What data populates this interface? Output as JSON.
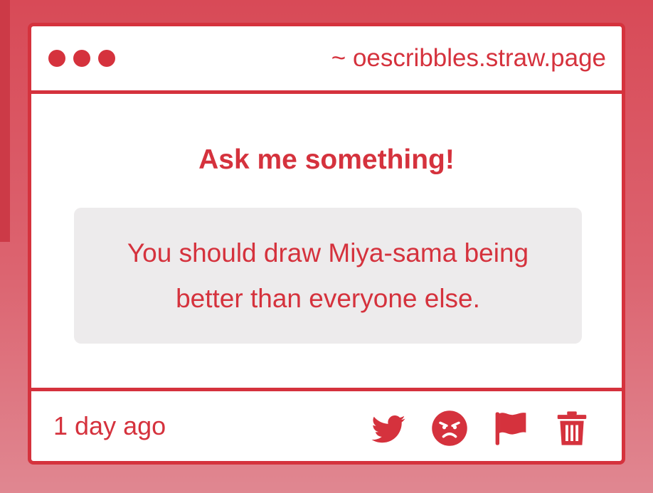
{
  "window": {
    "url": "~ oescribbles.straw.page",
    "controls": [
      "dot-icon",
      "dot-icon",
      "dot-icon"
    ]
  },
  "main": {
    "prompt": "Ask me something!",
    "question": "You should draw Miya-sama being better than everyone else."
  },
  "footer": {
    "timestamp": "1 day ago",
    "actions": [
      {
        "icon": "twitter-icon"
      },
      {
        "icon": "angry-face-icon"
      },
      {
        "icon": "flag-icon"
      },
      {
        "icon": "trash-icon"
      }
    ]
  },
  "colors": {
    "accent": "#d5323d",
    "question_bg": "#edebec",
    "background_top": "#d84a57",
    "background_bottom": "#e08791"
  }
}
